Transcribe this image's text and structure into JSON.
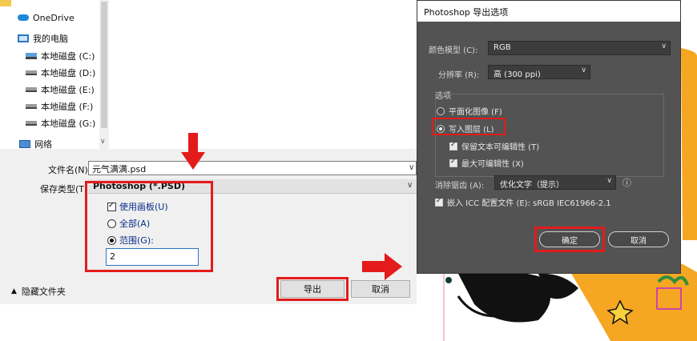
{
  "explorer": {
    "nav_items": [
      {
        "label": "OneDrive",
        "icon": "cloud-icon"
      },
      {
        "label": "我的电脑",
        "icon": "computer-icon"
      },
      {
        "label": "本地磁盘 (C:)",
        "icon": "drive-icon"
      },
      {
        "label": "本地磁盘 (D:)",
        "icon": "drive-icon"
      },
      {
        "label": "本地磁盘 (E:)",
        "icon": "drive-icon"
      },
      {
        "label": "本地磁盘 (F:)",
        "icon": "drive-icon"
      },
      {
        "label": "本地磁盘 (G:)",
        "icon": "drive-icon"
      },
      {
        "label": "网络",
        "icon": "network-icon"
      }
    ],
    "filename_label": "文件名(N):",
    "filename_value": "元气满满.psd",
    "filetype_label": "保存类型(T):",
    "filetype_value": "Photoshop (*.PSD)",
    "options": {
      "use_artboards": "使用画板(U)",
      "all": "全部(A)",
      "range": "范围(G):",
      "range_value": "2"
    },
    "hide_folders": "隐藏文件夹",
    "export_button": "导出",
    "cancel_button": "取消"
  },
  "ps_dialog": {
    "title": "Photoshop 导出选项",
    "color_model_label": "颜色模型 (C):",
    "color_model_value": "RGB",
    "resolution_label": "分辨率 (R):",
    "resolution_value": "高 (300 ppi)",
    "options_label": "选项",
    "flatten": "平面化图像 (F)",
    "write_layers": "写入图层 (L)",
    "keep_text_editable": "保留文本可编辑性 (T)",
    "max_editability": "最大可编辑性 (X)",
    "antialias_label": "消除锯齿 (A):",
    "antialias_value": "优化文字（提示）",
    "embed_icc": "嵌入 ICC 配置文件 (E): sRGB IEC61966-2.1",
    "ok_button": "确定",
    "cancel_button": "取消"
  },
  "colors": {
    "highlight_red": "#e31b1b",
    "ps_background": "#535353",
    "art_orange": "#f5a623",
    "art_black": "#111111",
    "art_star": "#f7d23c"
  }
}
